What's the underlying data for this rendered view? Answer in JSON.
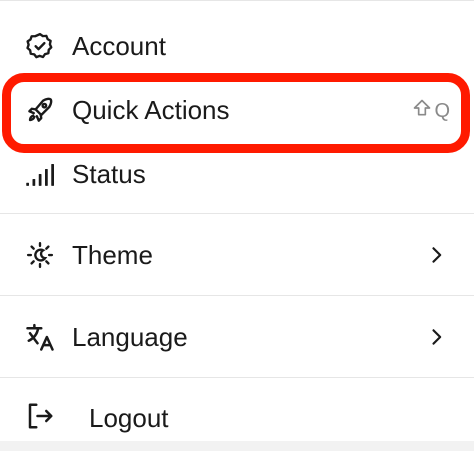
{
  "menu": {
    "items": [
      {
        "label": "Account",
        "icon": "check-badge-icon"
      },
      {
        "label": "Quick Actions",
        "icon": "rocket-icon",
        "shortcut": "Q",
        "shortcut_modifier": "shift-icon"
      },
      {
        "label": "Status",
        "icon": "signal-bars-icon"
      },
      {
        "label": "Theme",
        "icon": "sun-moon-icon",
        "submenu_icon": "chevron-right-icon"
      },
      {
        "label": "Language",
        "icon": "translate-icon",
        "submenu_icon": "chevron-right-icon"
      },
      {
        "label": "Logout",
        "icon": "logout-icon"
      }
    ]
  },
  "highlight": {
    "target": "Quick Actions",
    "color": "#ff1a00"
  }
}
